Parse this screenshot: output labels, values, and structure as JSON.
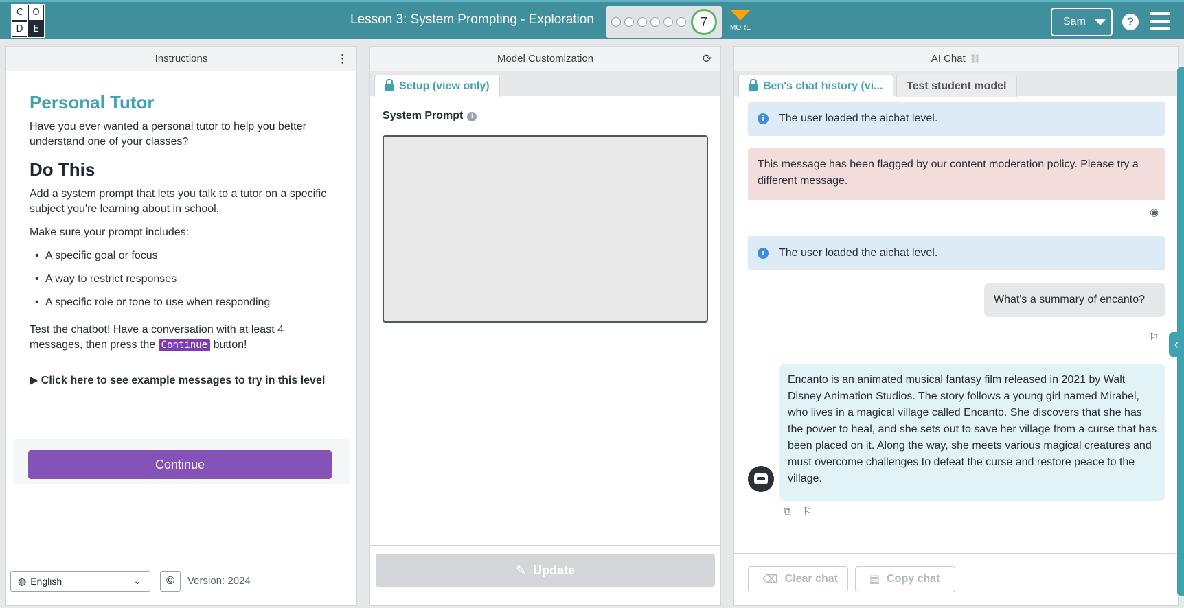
{
  "header": {
    "logo_letters": [
      "C",
      "O",
      "D",
      "E"
    ],
    "lesson_title": "Lesson 3: System Prompting - Exploration",
    "progress_dots": 6,
    "current_level": "7",
    "more_label": "MORE",
    "user_name": "Sam",
    "help_label": "?",
    "colors": {
      "bar": "#3f8f9c",
      "accent": "#ffa400",
      "level_ring": "#5cb85c"
    }
  },
  "instructions": {
    "panel_title": "Instructions",
    "menu_icon": "vertical-dots-icon",
    "heading": "Personal Tutor",
    "intro": "Have you ever wanted a personal tutor to help you better understand one of your classes?",
    "do_this_heading": "Do This",
    "task": "Add a system prompt that lets you talk to a tutor on a specific subject you're learning about in school.",
    "make_sure": "Make sure your prompt includes:",
    "bullets": [
      "A specific goal or focus",
      "A way to restrict responses",
      "A specific role or tone to use when responding"
    ],
    "test_before": "Test the chatbot! Have a conversation with at least 4 messages, then press the",
    "test_chip": "Continue",
    "test_after": "button!",
    "details_label": "Click here to see example messages to try in this level",
    "continue_label": "Continue",
    "language": "English",
    "copyright_symbol": "©",
    "version": "Version: 2024"
  },
  "model": {
    "panel_title": "Model Customization",
    "refresh_icon": "refresh-icon",
    "tab_label": "Setup (view only)",
    "system_prompt_label": "System Prompt",
    "system_prompt_value": "",
    "update_label": "Update"
  },
  "chat": {
    "panel_title": "AI Chat",
    "link_icon": "link-icon",
    "tab_history": "Ben's chat history (vi...",
    "tab_test": "Test student model",
    "messages": [
      {
        "role": "system",
        "text": "The user loaded the aichat level."
      },
      {
        "role": "flagged",
        "text": "This message has been flagged by our content moderation policy. Please try a different message."
      },
      {
        "role": "system",
        "text": "The user loaded the aichat level."
      },
      {
        "role": "user",
        "text": "What's a summary of encanto?"
      },
      {
        "role": "assistant",
        "text": "Encanto is an animated musical fantasy film released in 2021 by Walt Disney Animation Studios. The story follows a young girl named Mirabel, who lives in a magical village called Encanto. She discovers that she has the power to heal, and she sets out to save her village from a curse that has been placed on it. Along the way, she meets various magical creatures and must overcome challenges to defeat the curse and restore peace to the village."
      }
    ],
    "clear_label": "Clear chat",
    "copy_label": "Copy chat"
  }
}
